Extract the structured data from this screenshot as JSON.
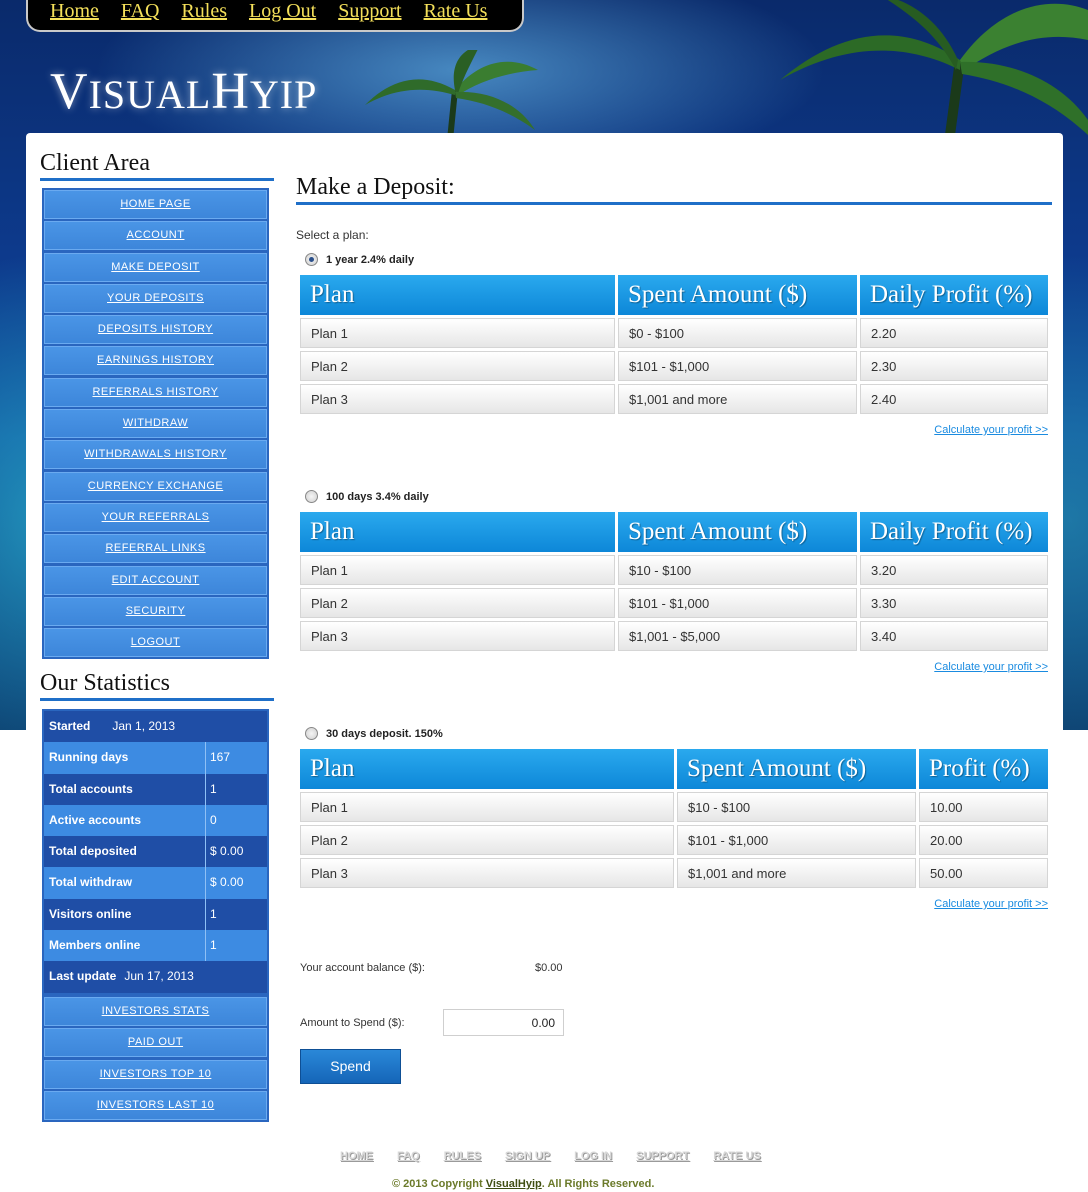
{
  "topnav": [
    "Home",
    "FAQ",
    "Rules",
    "Log Out",
    "Support",
    "Rate Us"
  ],
  "logo": {
    "big1": "V",
    "rest1": "ISUAL",
    "big2": "H",
    "rest2": "YIP"
  },
  "client_area": {
    "title": "Client Area",
    "items": [
      "HOME PAGE",
      "ACCOUNT",
      "MAKE DEPOSIT",
      "YOUR DEPOSITS",
      "DEPOSITS HISTORY",
      "EARNINGS HISTORY",
      "REFERRALS HISTORY",
      "WITHDRAW",
      "WITHDRAWALS HISTORY",
      "CURRENCY EXCHANGE",
      "YOUR REFERRALS",
      "REFERRAL LINKS",
      "EDIT ACCOUNT",
      "SECURITY",
      "LOGOUT"
    ]
  },
  "statistics": {
    "title": "Our Statistics",
    "rows": [
      {
        "label": "Started",
        "value": "Jan 1, 2013"
      },
      {
        "label": "Running days",
        "value": "167"
      },
      {
        "label": "Total accounts",
        "value": "1"
      },
      {
        "label": "Active accounts",
        "value": "0"
      },
      {
        "label": "Total deposited",
        "value": "$ 0.00"
      },
      {
        "label": "Total withdraw",
        "value": "$ 0.00"
      },
      {
        "label": "Visitors online",
        "value": "1"
      },
      {
        "label": "Members online",
        "value": "1"
      },
      {
        "label": "Last update",
        "value": "Jun 17, 2013"
      }
    ],
    "links": [
      "INVESTORS STATS",
      "PAID OUT",
      "INVESTORS TOP 10",
      "INVESTORS LAST 10"
    ]
  },
  "deposit": {
    "title": "Make a Deposit:",
    "select_label": "Select a plan:",
    "calc_label": "Calculate your profit >>",
    "plans": [
      {
        "name": "1 year 2.4% daily",
        "selected": true,
        "headers": [
          "Plan",
          "Spent Amount ($)",
          "Daily Profit (%)"
        ],
        "rows": [
          [
            "Plan 1",
            "$0 - $100",
            "2.20"
          ],
          [
            "Plan 2",
            "$101 - $1,000",
            "2.30"
          ],
          [
            "Plan 3",
            "$1,001 and more",
            "2.40"
          ]
        ]
      },
      {
        "name": "100 days 3.4% daily",
        "selected": false,
        "headers": [
          "Plan",
          "Spent Amount ($)",
          "Daily Profit (%)"
        ],
        "rows": [
          [
            "Plan 1",
            "$10 - $100",
            "3.20"
          ],
          [
            "Plan 2",
            "$101 - $1,000",
            "3.30"
          ],
          [
            "Plan 3",
            "$1,001 - $5,000",
            "3.40"
          ]
        ]
      },
      {
        "name": "30 days deposit. 150%",
        "selected": false,
        "headers": [
          "Plan",
          "Spent Amount ($)",
          "Profit (%)"
        ],
        "rows": [
          [
            "Plan 1",
            "$10 - $100",
            "10.00"
          ],
          [
            "Plan 2",
            "$101 - $1,000",
            "20.00"
          ],
          [
            "Plan 3",
            "$1,001 and more",
            "50.00"
          ]
        ]
      }
    ],
    "balance_label": "Your account balance ($):",
    "balance_value": "$0.00",
    "amount_label": "Amount to Spend ($):",
    "amount_value": "0.00",
    "spend_label": "Spend"
  },
  "footer": {
    "links": [
      "HOME",
      "FAQ",
      "RULES",
      "SIGN UP",
      "LOG IN",
      "SUPPORT",
      "RATE US"
    ],
    "copyright_prefix": "© 2013 Copyright ",
    "copyright_link": "VisualHyip",
    "copyright_suffix": ". All Rights Reserved."
  }
}
